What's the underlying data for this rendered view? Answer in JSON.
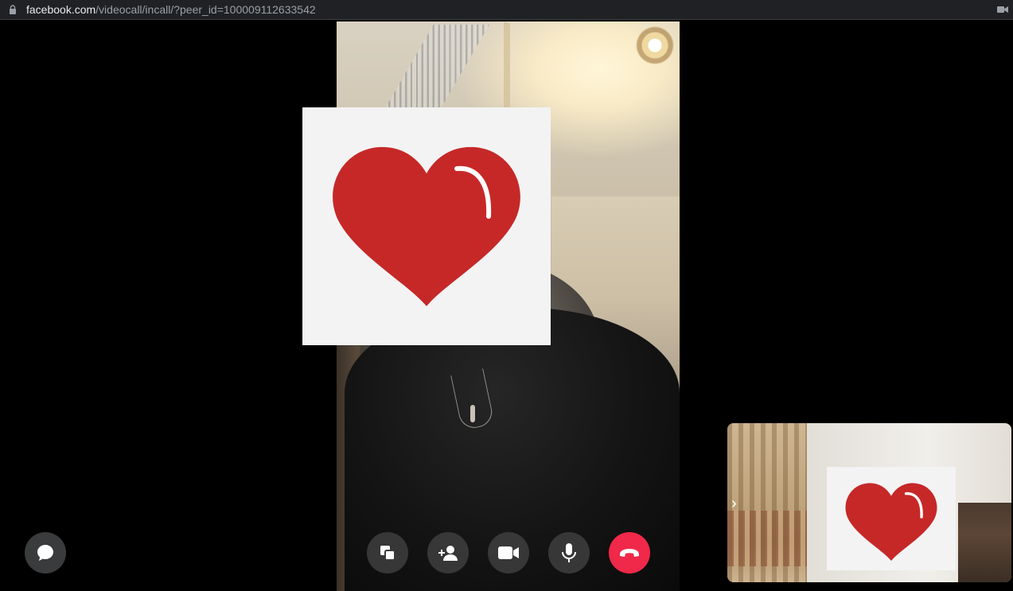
{
  "browser": {
    "url_domain": "facebook.com",
    "url_path": "/videocall/incall/?peer_id=100009112633542",
    "lock_icon": "lock-icon",
    "camera_indicator_icon": "camera-indicator-icon"
  },
  "call": {
    "controls": [
      {
        "name": "share-screen-button",
        "icon": "share-screen-icon"
      },
      {
        "name": "add-person-button",
        "icon": "add-person-icon"
      },
      {
        "name": "video-toggle-button",
        "icon": "video-camera-icon"
      },
      {
        "name": "mute-button",
        "icon": "microphone-icon"
      },
      {
        "name": "end-call-button",
        "icon": "hang-up-icon"
      }
    ],
    "chat_button_icon": "chat-bubble-icon",
    "self_view_chevron": "›",
    "colors": {
      "end_call": "#f02849",
      "control_bg": "#3c3c3c",
      "heart": "#c62828",
      "sticker_bg": "#f3f3f3"
    }
  }
}
